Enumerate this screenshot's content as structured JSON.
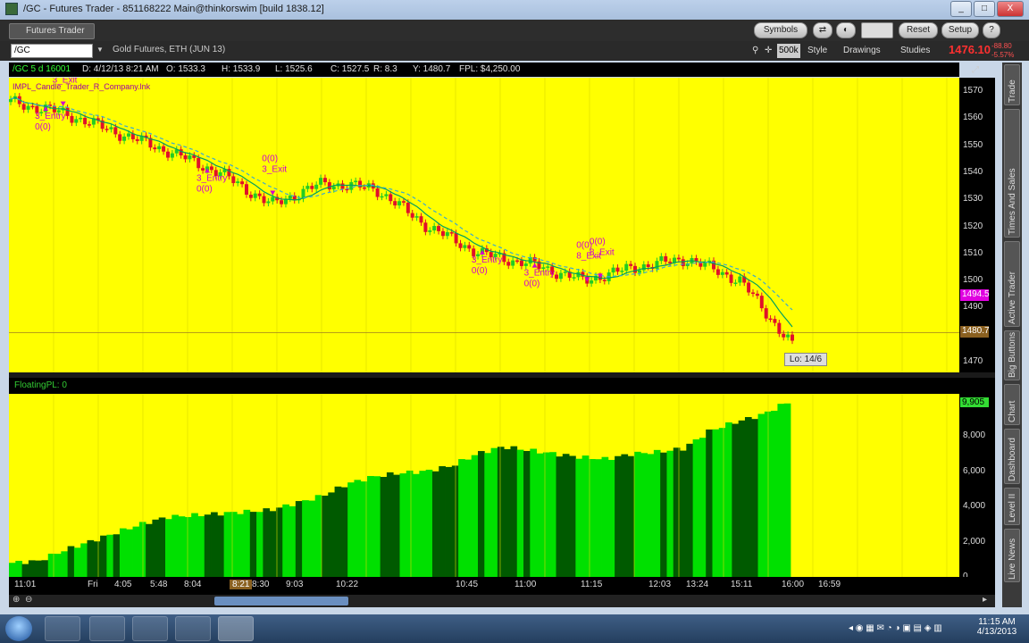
{
  "window": {
    "title": "/GC - Futures Trader - 851168222 Main@thinkorswim [build 1838.12]",
    "controls": [
      "_",
      "□",
      "X"
    ]
  },
  "tabbar": {
    "tab_label": "Futures Trader",
    "buttons": [
      "Symbols",
      "Reset",
      "Setup"
    ]
  },
  "symbol_row": {
    "symbol": "/GC",
    "description": "Gold Futures, ETH (JUN 13)",
    "period": "500k",
    "style_label": "Style",
    "drawings_label": "Drawings",
    "studies_label": "Studies",
    "last_price": "1476.10",
    "change": "-88.80",
    "change_pct": "-5.57%"
  },
  "infobar": {
    "items": [
      "/GC 5 d 16001",
      "D: 4/12/13 8:21 AM",
      "O: 1533.3",
      "H: 1533.9",
      "L: 1525.6",
      "C: 1527.5",
      "R: 8.3",
      "Y: 1480.7",
      "FPL: $4,250.00"
    ]
  },
  "upper_chart": {
    "legend": "IMPL_Candle_Trader_R_Company.lnk",
    "price_scale": [
      "1570",
      "1560",
      "1550",
      "1540",
      "1530",
      "1520",
      "1510",
      "1500",
      "1490",
      "1470"
    ],
    "current_price_tag": "1480.7",
    "cursor_price_tag": "1494.5",
    "low_label": "Lo: 14/6",
    "signals": [
      {
        "text": "3_Entry\n0(0)"
      },
      {
        "text": "0(0)\n3_Exit"
      },
      {
        "text": "3_Entry\n0(0)"
      },
      {
        "text": "0(0)\n3_Exit"
      },
      {
        "text": "3_Entry\n0(0)"
      },
      {
        "text": "0(0)\n8_Exit"
      },
      {
        "text": "3_Entry\n0(0)"
      },
      {
        "text": "0(0)\n8_Exit"
      }
    ]
  },
  "lower_chart": {
    "title": "FloatingPL: 0",
    "scale": [
      "9,905",
      "8,000",
      "6,000",
      "4,000",
      "2,000",
      "0"
    ],
    "last_value_tag": "9,905"
  },
  "time_axis": {
    "labels": [
      "11:01",
      "Fri",
      "4:05",
      "5:48",
      "8:04",
      "8:21",
      "8:30",
      "9:03",
      "10:22",
      "10:45",
      "11:00",
      "11:15",
      "12:03",
      "13:24",
      "15:11",
      "16:00",
      "16:59"
    ],
    "cursor_label": "8:21"
  },
  "side_tabs": [
    "Trade",
    "Times And Sales",
    "Active Trader",
    "Big Buttons",
    "Chart",
    "Dashboard",
    "Level II",
    "Live News"
  ],
  "taskbar": {
    "time": "11:15 AM",
    "date": "4/13/2013"
  },
  "colors": {
    "chart_bg": "#ffff00",
    "down_candle": "#e0102a",
    "up_candle": "#22cc22",
    "signal": "#d000d0",
    "bar_bright": "#00e000",
    "bar_dark": "#005a00"
  },
  "chart_data": [
    {
      "type": "line",
      "description_series": "price",
      "x": [
        "11:01",
        "Fri",
        "4:05",
        "5:48",
        "8:04",
        "8:21",
        "8:30",
        "9:03",
        "10:22",
        "10:45",
        "11:00",
        "11:15",
        "12:03",
        "13:24",
        "15:11",
        "16:00"
      ],
      "values": [
        1566,
        1562,
        1555,
        1548,
        1540,
        1528,
        1536,
        1534,
        1520,
        1510,
        1506,
        1500,
        1505,
        1508,
        1500,
        1476
      ],
      "ylim": [
        1466,
        1575
      ]
    },
    {
      "type": "bar",
      "title": "FloatingPL: 0",
      "values": [
        800,
        900,
        1500,
        2000,
        2500,
        3000,
        3400,
        3500,
        3600,
        3700,
        3800,
        4200,
        4600,
        5300,
        5700,
        5900,
        6000,
        6300,
        7000,
        7400,
        7200,
        7000,
        6800,
        6700,
        7000,
        7100,
        7300,
        8300,
        8800,
        9200,
        9905
      ],
      "ylim": [
        0,
        10000
      ]
    }
  ]
}
